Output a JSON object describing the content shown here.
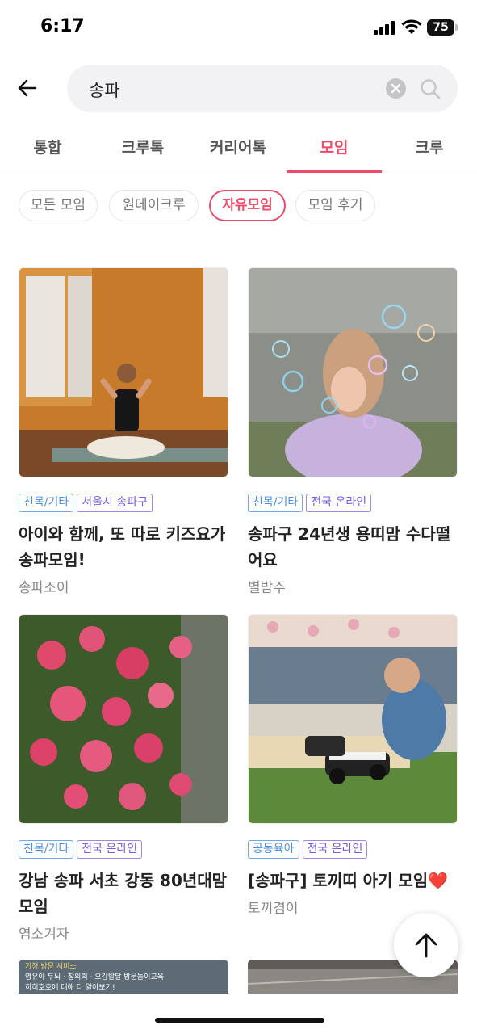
{
  "status": {
    "time": "6:17",
    "battery": "75"
  },
  "search": {
    "query": "송파"
  },
  "tabs": [
    {
      "label": "통합"
    },
    {
      "label": "크루톡"
    },
    {
      "label": "커리어톡"
    },
    {
      "label": "모임",
      "active": true
    },
    {
      "label": "크루"
    }
  ],
  "chips": [
    {
      "label": "모든 모임"
    },
    {
      "label": "원데이크루"
    },
    {
      "label": "자유모임",
      "active": true
    },
    {
      "label": "모임 후기"
    }
  ],
  "cards": [
    {
      "tags": [
        "친목/기타",
        "서울시 송파구"
      ],
      "title": "아이와 함께, 또 따로 키즈요가 송파모임!",
      "author": "송파조이",
      "image": "yoga-photo"
    },
    {
      "tags": [
        "친목/기타",
        "전국 온라인"
      ],
      "title": "송파구 24년생 용띠맘 수다떨어요",
      "author": "별밤주",
      "image": "bubbles-photo"
    },
    {
      "tags": [
        "친목/기타",
        "전국 온라인"
      ],
      "title": "강남 송파 서초 강동 80년대맘 모임",
      "author": "염소겨자",
      "image": "roses-photo"
    },
    {
      "tags": [
        "공동육아",
        "전국 온라인"
      ],
      "title": "[송파구] 토끼띠 아기 모임❤️",
      "author": "토끼겸이",
      "image": "toy-car-photo"
    }
  ],
  "peek_card": {
    "line1": "가정 방문 서비스",
    "line2": "영유아 두뇌 · 창의력 · 오감발달 방문놀이교육",
    "line3": "히히호호에 대해 더 알아보기!"
  },
  "colors": {
    "accent": "#ee4b6a",
    "tag_blue": "#4a8fe0",
    "tag_purple": "#7a5ae0"
  },
  "icons": [
    "back-arrow-icon",
    "clear-icon",
    "search-icon",
    "scroll-top-icon"
  ]
}
